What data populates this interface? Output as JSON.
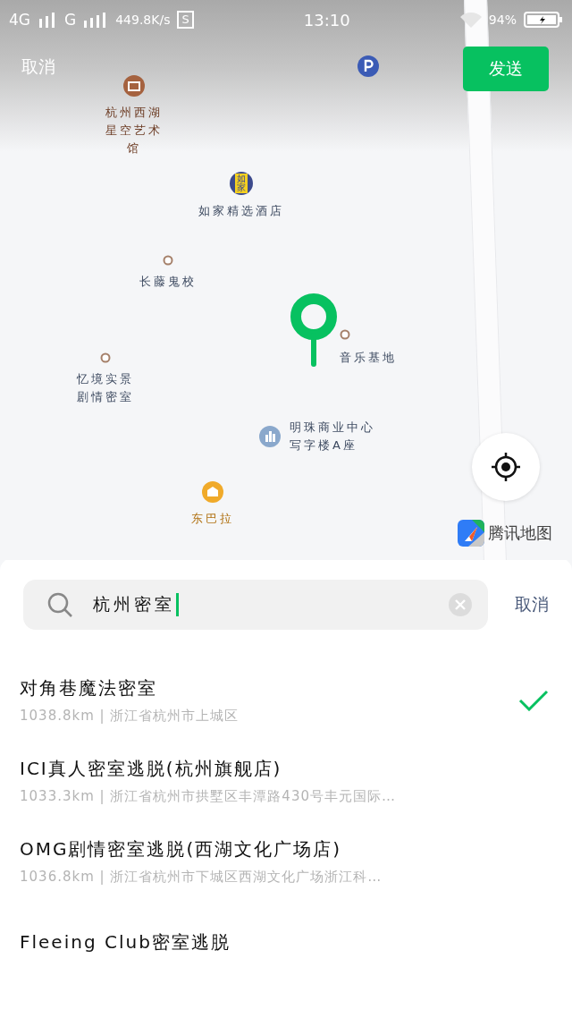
{
  "status_bar": {
    "network_1": "4G",
    "network_2": "G",
    "speed": "449.8K/s",
    "app_badge": "S",
    "time": "13:10",
    "battery": "94%"
  },
  "header": {
    "cancel": "取消",
    "send": "发送"
  },
  "map": {
    "pois": [
      {
        "kind": "museum",
        "label": "杭州西湖星空艺术馆",
        "color": "#a5623f"
      },
      {
        "kind": "parking",
        "color": "#3b5bb5"
      },
      {
        "kind": "hotel",
        "label": "如家精选酒店",
        "badge": "如家",
        "color": "#3c4a8c"
      },
      {
        "kind": "dot",
        "label": "长藤鬼校",
        "color": "#a5806a"
      },
      {
        "kind": "dot",
        "label": "音乐基地",
        "color": "#a5806a"
      },
      {
        "kind": "dot",
        "label": "忆境实景剧情密室",
        "color": "#a5806a"
      },
      {
        "kind": "office",
        "label": "明珠商业中心写字楼A座",
        "color": "#8aa8cc"
      },
      {
        "kind": "shop",
        "label": "东巴拉",
        "color": "#f0aa2a"
      }
    ],
    "brand": "腾讯地图"
  },
  "search": {
    "value": "杭州密室",
    "cancel": "取消"
  },
  "results": [
    {
      "name": "对角巷魔法密室",
      "detail": "1038.8km | 浙江省杭州市上城区",
      "selected": true
    },
    {
      "name": "ICI真人密室逃脱(杭州旗舰店)",
      "detail": "1033.3km | 浙江省杭州市拱墅区丰潭路430号丰元国际…",
      "selected": false
    },
    {
      "name": "OMG剧情密室逃脱(西湖文化广场店)",
      "detail": "1036.8km | 浙江省杭州市下城区西湖文化广场浙江科…",
      "selected": false
    },
    {
      "name": "Fleeing Club密室逃脱",
      "selected": false
    }
  ]
}
